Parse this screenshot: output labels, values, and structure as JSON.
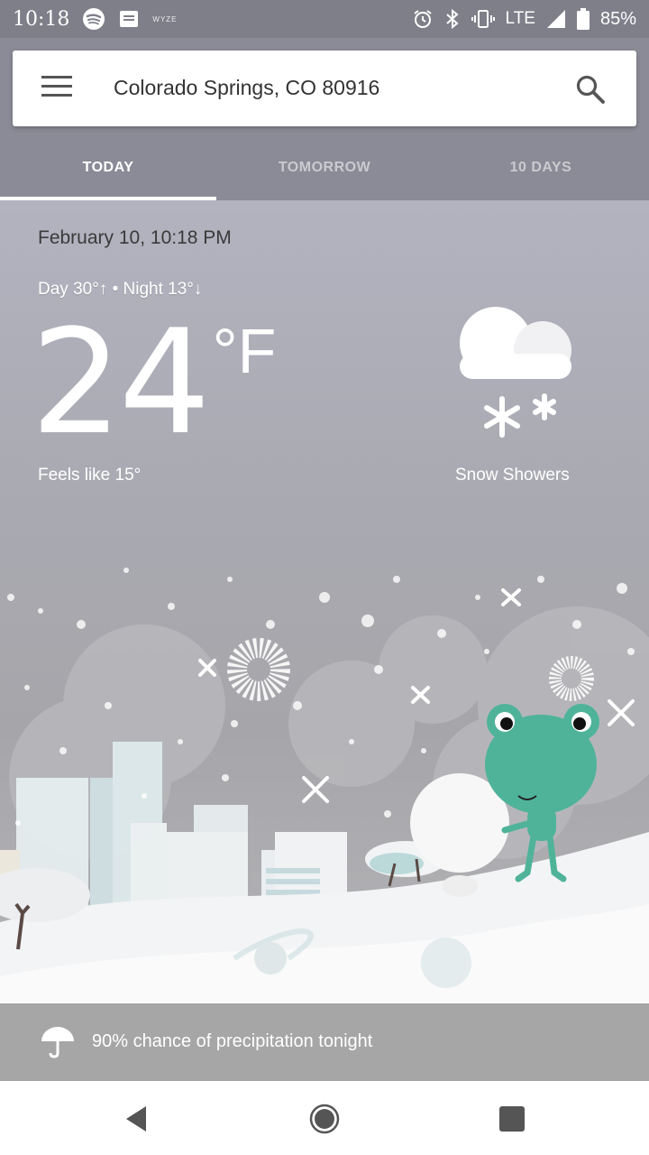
{
  "status_bar": {
    "time": "10:18",
    "app_label": "WYZE",
    "network": "LTE",
    "battery": "85%",
    "icons": [
      "spotify-icon",
      "message-icon",
      "alarm-icon",
      "bluetooth-icon",
      "vibrate-icon",
      "signal-icon",
      "battery-icon"
    ]
  },
  "search": {
    "location": "Colorado Springs, CO 80916",
    "icons": [
      "menu-icon",
      "search-icon"
    ]
  },
  "tabs": [
    {
      "label": "TODAY",
      "active": true
    },
    {
      "label": "TOMORROW",
      "active": false
    },
    {
      "label": "10 DAYS",
      "active": false
    }
  ],
  "weather": {
    "date_time": "February 10, 10:18 PM",
    "day_night": "Day 30°↑ • Night 13°↓",
    "temperature": "24",
    "unit": "°F",
    "feels_like": "Feels like 15°",
    "condition": "Snow Showers",
    "condition_icon": "snow-cloud-icon"
  },
  "precipitation": {
    "text": "90% chance of precipitation tonight",
    "icon": "umbrella-icon"
  },
  "nav": {
    "icons": [
      "back-icon",
      "home-icon",
      "recents-icon"
    ]
  },
  "colors": {
    "header_bg": "#8a8b96",
    "status_bg": "#7e7f89",
    "frog": "#4fb39a"
  }
}
